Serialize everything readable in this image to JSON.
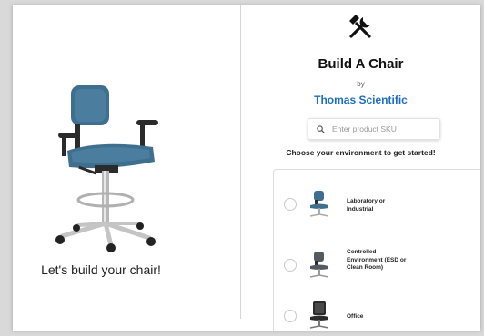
{
  "left_panel": {
    "caption": "Let's build your chair!",
    "hero_image": "blue-lab-chair"
  },
  "right_panel": {
    "logo_icon": "tools-hammer-wrench-icon",
    "title": "Build A Chair",
    "by_text": "by",
    "brand": "Thomas Scientific",
    "search": {
      "placeholder": "Enter product SKU",
      "value": ""
    },
    "prompt": "Choose your environment to get started!",
    "options": [
      {
        "label_lines": [
          "Laboratory or",
          "Industrial"
        ],
        "thumbnail": "lab-chair-thumb",
        "selected": false
      },
      {
        "label_lines": [
          "Controlled",
          "Environment (ESD or",
          "Clean Room)"
        ],
        "thumbnail": "esd-chair-thumb",
        "selected": false
      },
      {
        "label_lines": [
          "Office"
        ],
        "thumbnail": "office-chair-thumb",
        "selected": false
      }
    ]
  },
  "colors": {
    "brand": "#1c6ec2",
    "chair_fabric": "#3f6f8f",
    "background": "#d9d9d9"
  }
}
